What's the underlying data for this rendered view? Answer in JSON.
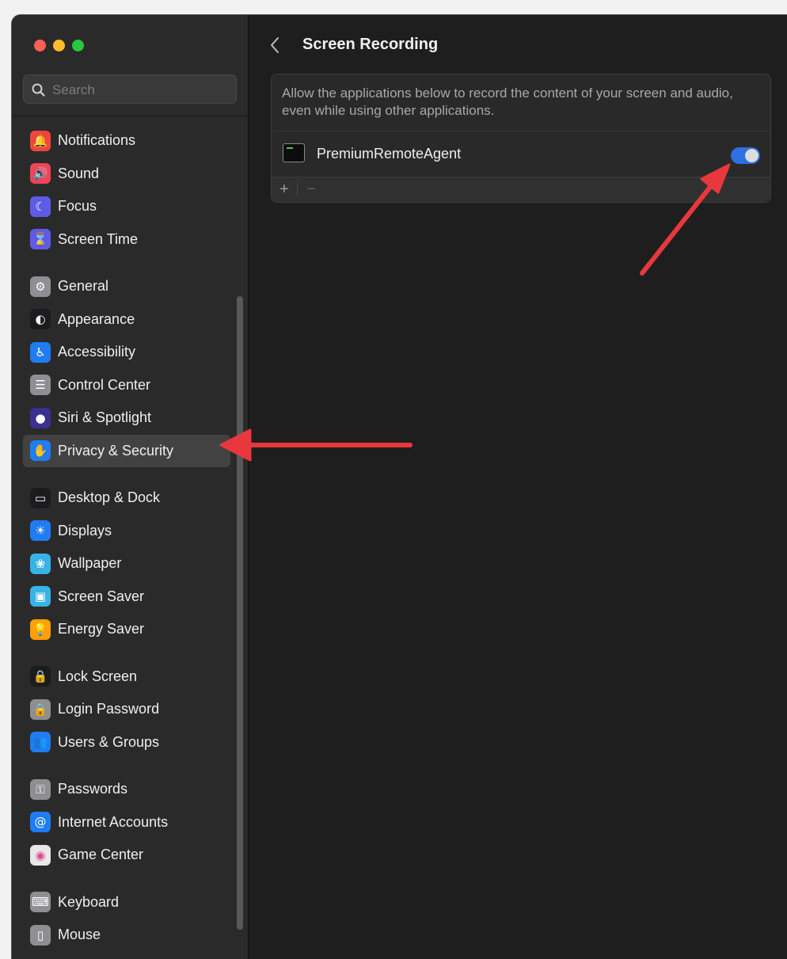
{
  "window": {
    "traffic_lights": [
      {
        "name": "close",
        "color": "#ff5f57"
      },
      {
        "name": "minimize",
        "color": "#febc2e"
      },
      {
        "name": "zoom",
        "color": "#28c840"
      }
    ]
  },
  "search": {
    "placeholder": "Search",
    "icon": "magnifier-icon"
  },
  "sidebar": {
    "selected_index": 9,
    "items": [
      {
        "label": "Notifications",
        "icon": "bell-icon",
        "color": "#f0453f"
      },
      {
        "label": "Sound",
        "icon": "speaker-icon",
        "color": "#f0445a"
      },
      {
        "label": "Focus",
        "icon": "moon-icon",
        "color": "#5e5ce6"
      },
      {
        "label": "Screen Time",
        "icon": "hourglass-icon",
        "color": "#5e5ce6"
      },
      {
        "label": "General",
        "icon": "gear-icon",
        "color": "#8e8e93"
      },
      {
        "label": "Appearance",
        "icon": "appearance-icon",
        "color": "#1c1c1e"
      },
      {
        "label": "Accessibility",
        "icon": "accessibility-icon",
        "color": "#1f7cf2"
      },
      {
        "label": "Control Center",
        "icon": "switches-icon",
        "color": "#8e8e93"
      },
      {
        "label": "Siri & Spotlight",
        "icon": "siri-icon",
        "color": "#3b2f8f"
      },
      {
        "label": "Privacy & Security",
        "icon": "hand-icon",
        "color": "#1f7cf2"
      },
      {
        "label": "Desktop & Dock",
        "icon": "dock-icon",
        "color": "#1c1c1e"
      },
      {
        "label": "Displays",
        "icon": "sun-icon",
        "color": "#1f7cf2"
      },
      {
        "label": "Wallpaper",
        "icon": "flower-icon",
        "color": "#37b3e6"
      },
      {
        "label": "Screen Saver",
        "icon": "screensaver-icon",
        "color": "#37b3e6"
      },
      {
        "label": "Energy Saver",
        "icon": "lightbulb-icon",
        "color": "#ff9f0a"
      },
      {
        "label": "Lock Screen",
        "icon": "lock-screen-icon",
        "color": "#1c1c1e"
      },
      {
        "label": "Login Password",
        "icon": "lock-icon",
        "color": "#8e8e93"
      },
      {
        "label": "Users & Groups",
        "icon": "users-icon",
        "color": "#1f7cf2"
      },
      {
        "label": "Passwords",
        "icon": "key-icon",
        "color": "#8e8e93"
      },
      {
        "label": "Internet Accounts",
        "icon": "at-icon",
        "color": "#1f7cf2"
      },
      {
        "label": "Game Center",
        "icon": "game-center-icon",
        "color": "#e8e8e8"
      },
      {
        "label": "Keyboard",
        "icon": "keyboard-icon",
        "color": "#8e8e93"
      },
      {
        "label": "Mouse",
        "icon": "mouse-icon",
        "color": "#8e8e93"
      }
    ]
  },
  "main": {
    "title": "Screen Recording",
    "description": "Allow the applications below to record the content of your screen and audio, even while using other applications.",
    "apps": [
      {
        "name": "PremiumRemoteAgent",
        "icon": "terminal-app-icon",
        "enabled": true
      }
    ],
    "add_label": "+",
    "remove_label": "−"
  },
  "colors": {
    "accent": "#2f6fdf",
    "annotation_arrow": "#e8383d"
  }
}
